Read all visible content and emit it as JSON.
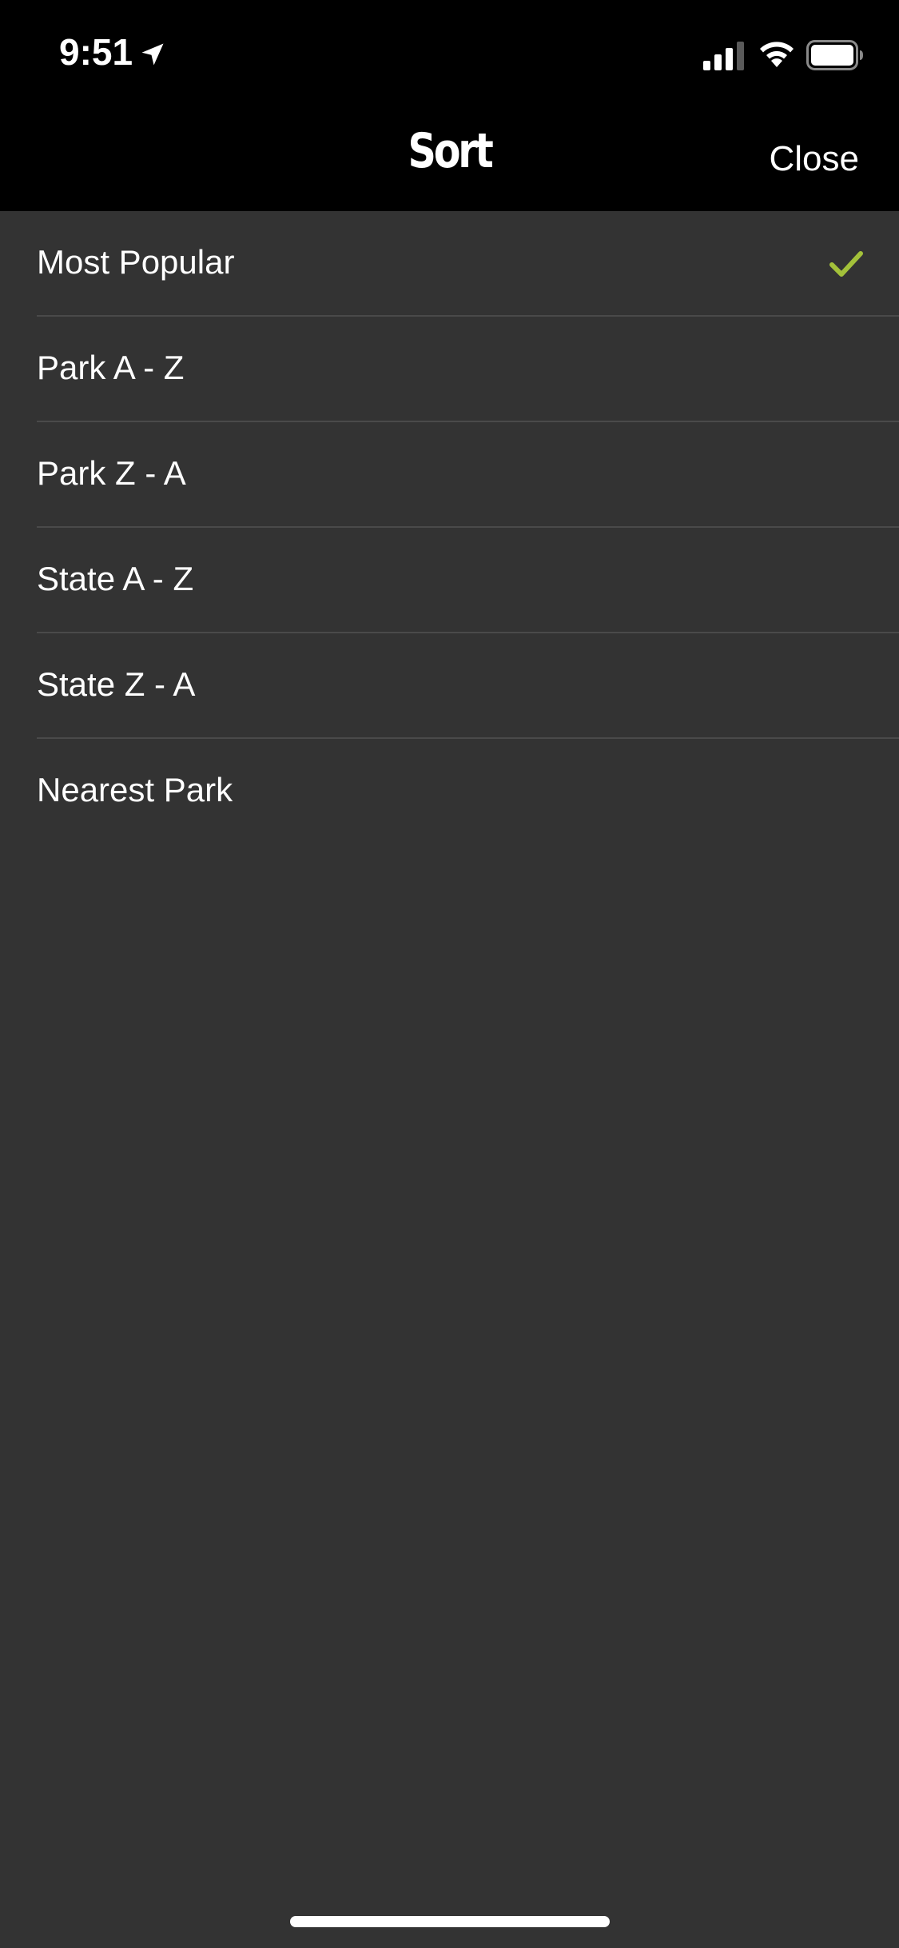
{
  "status_bar": {
    "time": "9:51",
    "icons": [
      "location-arrow-icon",
      "cellular-signal-icon",
      "wifi-icon",
      "battery-icon"
    ]
  },
  "nav": {
    "title": "Sort",
    "close_label": "Close"
  },
  "sort_options": [
    {
      "label": "Most Popular",
      "selected": true
    },
    {
      "label": "Park A - Z",
      "selected": false
    },
    {
      "label": "Park Z - A",
      "selected": false
    },
    {
      "label": "State A - Z",
      "selected": false
    },
    {
      "label": "State Z - A",
      "selected": false
    },
    {
      "label": "Nearest Park",
      "selected": false
    }
  ],
  "colors": {
    "background": "#333333",
    "bar_background": "#000000",
    "accent_check": "#a3c13a",
    "separator": "#4a4a4a",
    "text": "#ffffff"
  }
}
